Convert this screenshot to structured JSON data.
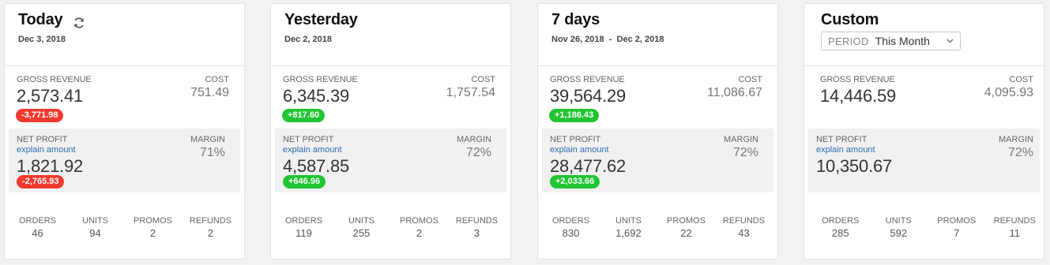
{
  "explain_label": "explain amount",
  "colors": {
    "down": "#f03a2e",
    "up": "#21c533",
    "link": "#2d6cae"
  },
  "cards": [
    {
      "title": "Today",
      "date": "Dec 3, 2018",
      "revenue": {
        "label": "GROSS REVENUE",
        "value": "2,573.41",
        "delta": "-3,771.98"
      },
      "cost": {
        "label": "COST",
        "value": "751.49"
      },
      "profit": {
        "label": "NET PROFIT",
        "value": "1,821.92",
        "delta": "-2,765.93"
      },
      "margin": {
        "label": "MARGIN",
        "value": "71%"
      },
      "stats": [
        {
          "label": "ORDERS",
          "value": "46"
        },
        {
          "label": "UNITS",
          "value": "94"
        },
        {
          "label": "PROMOS",
          "value": "2"
        },
        {
          "label": "REFUNDS",
          "value": "2"
        }
      ]
    },
    {
      "title": "Yesterday",
      "date": "Dec 2, 2018",
      "revenue": {
        "label": "GROSS REVENUE",
        "value": "6,345.39",
        "delta": "+817.60"
      },
      "cost": {
        "label": "COST",
        "value": "1,757.54"
      },
      "profit": {
        "label": "NET PROFIT",
        "value": "4,587.85",
        "delta": "+646.96"
      },
      "margin": {
        "label": "MARGIN",
        "value": "72%"
      },
      "stats": [
        {
          "label": "ORDERS",
          "value": "119"
        },
        {
          "label": "UNITS",
          "value": "255"
        },
        {
          "label": "PROMOS",
          "value": "2"
        },
        {
          "label": "REFUNDS",
          "value": "3"
        }
      ]
    },
    {
      "title": "7 days",
      "date": "Nov 26, 2018  -  Dec 2, 2018",
      "revenue": {
        "label": "GROSS REVENUE",
        "value": "39,564.29",
        "delta": "+1,186.43"
      },
      "cost": {
        "label": "COST",
        "value": "11,086.67"
      },
      "profit": {
        "label": "NET PROFIT",
        "value": "28,477.62",
        "delta": "+2,033.66"
      },
      "margin": {
        "label": "MARGIN",
        "value": "72%"
      },
      "stats": [
        {
          "label": "ORDERS",
          "value": "830"
        },
        {
          "label": "UNITS",
          "value": "1,692"
        },
        {
          "label": "PROMOS",
          "value": "22"
        },
        {
          "label": "REFUNDS",
          "value": "43"
        }
      ]
    },
    {
      "title": "Custom",
      "period": {
        "label": "PERIOD",
        "value": "This Month"
      },
      "revenue": {
        "label": "GROSS REVENUE",
        "value": "14,446.59"
      },
      "cost": {
        "label": "COST",
        "value": "4,095.93"
      },
      "profit": {
        "label": "NET PROFIT",
        "value": "10,350.67"
      },
      "margin": {
        "label": "MARGIN",
        "value": "72%"
      },
      "stats": [
        {
          "label": "ORDERS",
          "value": "285"
        },
        {
          "label": "UNITS",
          "value": "592"
        },
        {
          "label": "PROMOS",
          "value": "7"
        },
        {
          "label": "REFUNDS",
          "value": "11"
        }
      ]
    }
  ]
}
